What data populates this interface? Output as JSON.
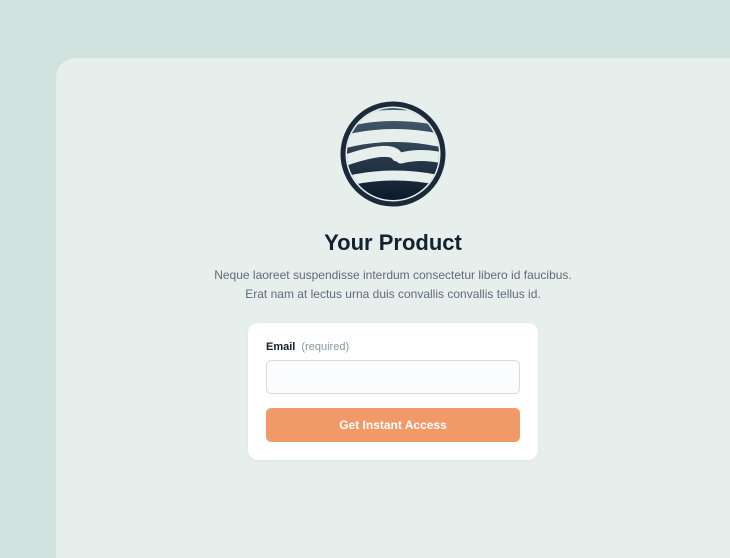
{
  "hero": {
    "title": "Your Product",
    "description": "Neque laoreet suspendisse interdum consectetur libero id faucibus. Erat nam at lectus urna duis convallis convallis tellus id."
  },
  "form": {
    "email_label": "Email",
    "email_required_hint": "(required)",
    "email_value": "",
    "submit_label": "Get Instant Access"
  },
  "colors": {
    "accent": "#f19a67",
    "page_bg": "#cfe2dd",
    "card_bg": "#e6efec"
  }
}
